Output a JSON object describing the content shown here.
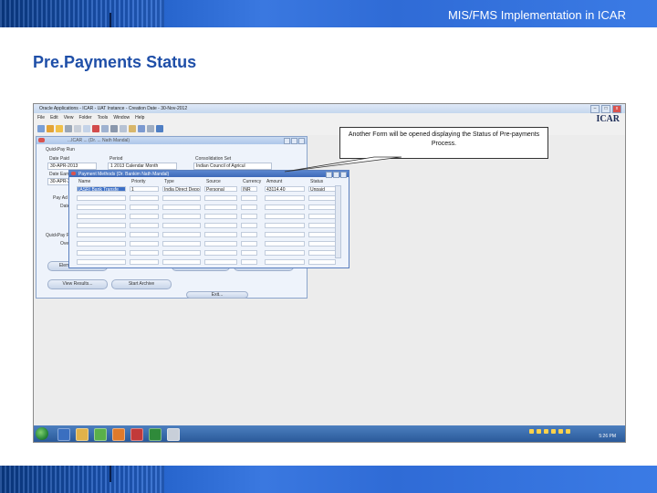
{
  "slide": {
    "header_title": "MIS/FMS Implementation in ICAR",
    "page_title": "Pre.Payments Status"
  },
  "callout": {
    "text": "Another Form will be opened displaying the Status of Pre-payments Process."
  },
  "app": {
    "window_title": "Oracle Applications - ICAR - UAT Instance - Creation Date - 30-Nov-2012",
    "brand": "ICAR",
    "menu": [
      "File",
      "Edit",
      "View",
      "Folder",
      "Tools",
      "Window",
      "Help"
    ],
    "window_controls": {
      "minimize": "–",
      "maximize": "□",
      "close": "x"
    }
  },
  "quickpay_form": {
    "title": "...ICAR ... (Dr. ... Nath Mandal)",
    "section_run": "QuickPay Run",
    "date_paid_label": "Date Paid",
    "date_paid_value": "30-APR-2013",
    "period_label": "Period",
    "period_value": "1 2013 Calendar Month",
    "consolidation_label": "Consolidation Set",
    "consolidation_value": "Indian Council of Agricul",
    "date_earned_label": "Date Earn",
    "date_earned_value": "30-APR-2",
    "pay_label": "Pay Ad",
    "date_label": "Date",
    "quickpay_pre_label": "QuickPay F",
    "over_label": "Over",
    "buttons": {
      "element_selection": "Element Selection",
      "retry": "Retry ... payments",
      "continue": "Continue Payment",
      "view_results": "View Results...",
      "start_archive": "Start Archive",
      "bottom": "Exit..."
    }
  },
  "payment_methods_form": {
    "title": "Payment Methods (Dr. Bankim Nath Mandal)",
    "columns": [
      "Name",
      "Priority",
      "Type",
      "Source",
      "Currency",
      "Amount",
      "Status"
    ],
    "rows": [
      [
        "IASRI Bank Transfe",
        "1",
        "India Direct Depo",
        "Personal",
        "INR",
        "43114.40",
        "Unpaid"
      ]
    ],
    "empty_rows": 8
  },
  "taskbar": {
    "clock": "5:26 PM"
  },
  "colors": {
    "header_blue": "#2f6bd6",
    "title_blue": "#1f4fa8",
    "form_title_blue": "#3d69b8",
    "selected_cell": "#3c6fc6"
  }
}
